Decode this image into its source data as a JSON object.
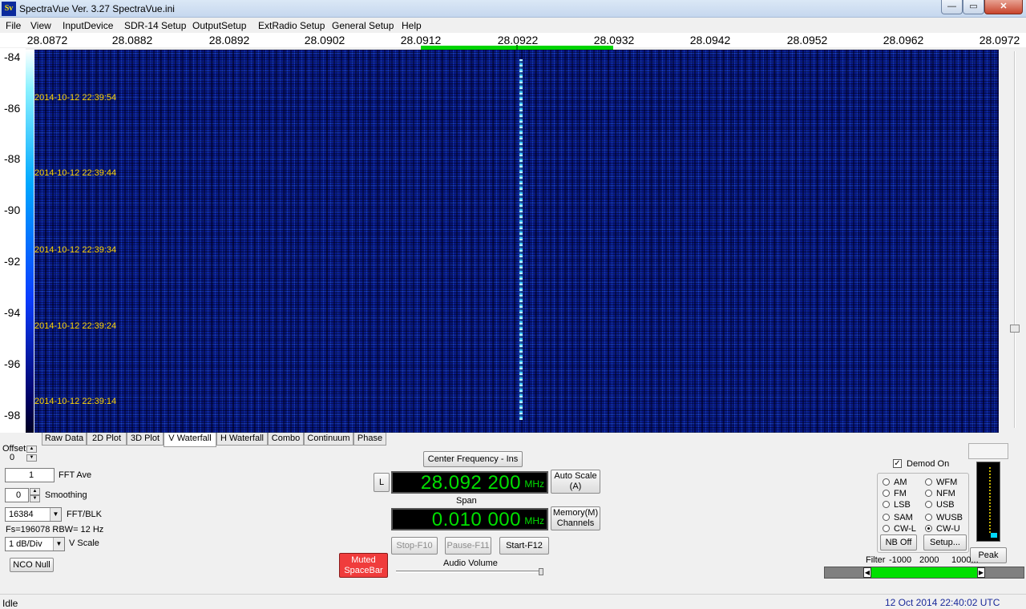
{
  "window": {
    "title": "SpectraVue Ver. 3.27  SpectraVue.ini",
    "icon": "Sv"
  },
  "window_buttons": {
    "minimize": "—",
    "maximize": "▭",
    "close": "✕"
  },
  "menu": [
    "File",
    "View",
    "InputDevice",
    "SDR-14 Setup",
    "OutputSetup",
    "ExtRadio Setup",
    "General Setup",
    "Help"
  ],
  "freq_labels": [
    "28.0872",
    "28.0882",
    "28.0892",
    "28.0902",
    "28.0912",
    "28.0922",
    "28.0932",
    "28.0942",
    "28.0952",
    "28.0962",
    "28.0972"
  ],
  "amp_labels": [
    "-84",
    "-86",
    "-88",
    "-90",
    "-92",
    "-94",
    "-96",
    "-98"
  ],
  "timestamps": [
    "2014-10-12 22:39:54",
    "2014-10-12 22:39:44",
    "2014-10-12 22:39:34",
    "2014-10-12 22:39:24",
    "2014-10-12 22:39:14"
  ],
  "tabs": [
    "Raw Data",
    "2D Plot",
    "3D Plot",
    "V Waterfall",
    "H Waterfall",
    "Combo",
    "Continuum",
    "Phase"
  ],
  "active_tab": "V Waterfall",
  "controls": {
    "offset_label": "Offset",
    "offset_value": "0",
    "fft_ave_value": "1",
    "fft_ave_label": "FFT Ave",
    "smoothing_value": "0",
    "smoothing_label": "Smoothing",
    "fft_blk_value": "16384",
    "fft_blk_label": "FFT/BLK",
    "fs_rbw": "Fs=196078 RBW=  12 Hz",
    "vscale_value": "1 dB/Div",
    "vscale_label": "V Scale",
    "nco_null": "NCO Null"
  },
  "center": {
    "center_freq_button": "Center Frequency - Ins",
    "l_button": "L",
    "frequency": "28.092 200",
    "freq_unit": "MHz",
    "auto_scale": "Auto Scale",
    "auto_scale_key": "(A)",
    "span_label": "Span",
    "span": "0.010 000",
    "span_unit": "MHz",
    "memory": "Memory(M)",
    "channels": "Channels",
    "stop": "Stop-F10",
    "pause": "Pause-F11",
    "start": "Start-F12",
    "muted": "Muted",
    "spacebar": "SpaceBar",
    "audio_volume": "Audio Volume"
  },
  "demod": {
    "demod_on_label": "Demod On",
    "demod_on_checked": true,
    "modes_left": [
      "AM",
      "FM",
      "LSB",
      "SAM",
      "CW-L"
    ],
    "modes_right": [
      "WFM",
      "NFM",
      "USB",
      "WUSB",
      "CW-U"
    ],
    "selected": "CW-U",
    "nb_off": "NB Off",
    "setup": "Setup...",
    "peak": "Peak",
    "filter_label": "Filter",
    "filter_low": "-1000",
    "filter_center": "2000",
    "filter_high": "1000..."
  },
  "status": {
    "left": "Idle",
    "right": "12 Oct 2014  22:40:02 UTC"
  },
  "colors": {
    "accent_green": "#00e000",
    "muted_red": "#f03c3c",
    "timestamp_yellow": "#ffd400",
    "date_blue": "#1a2a9a"
  }
}
